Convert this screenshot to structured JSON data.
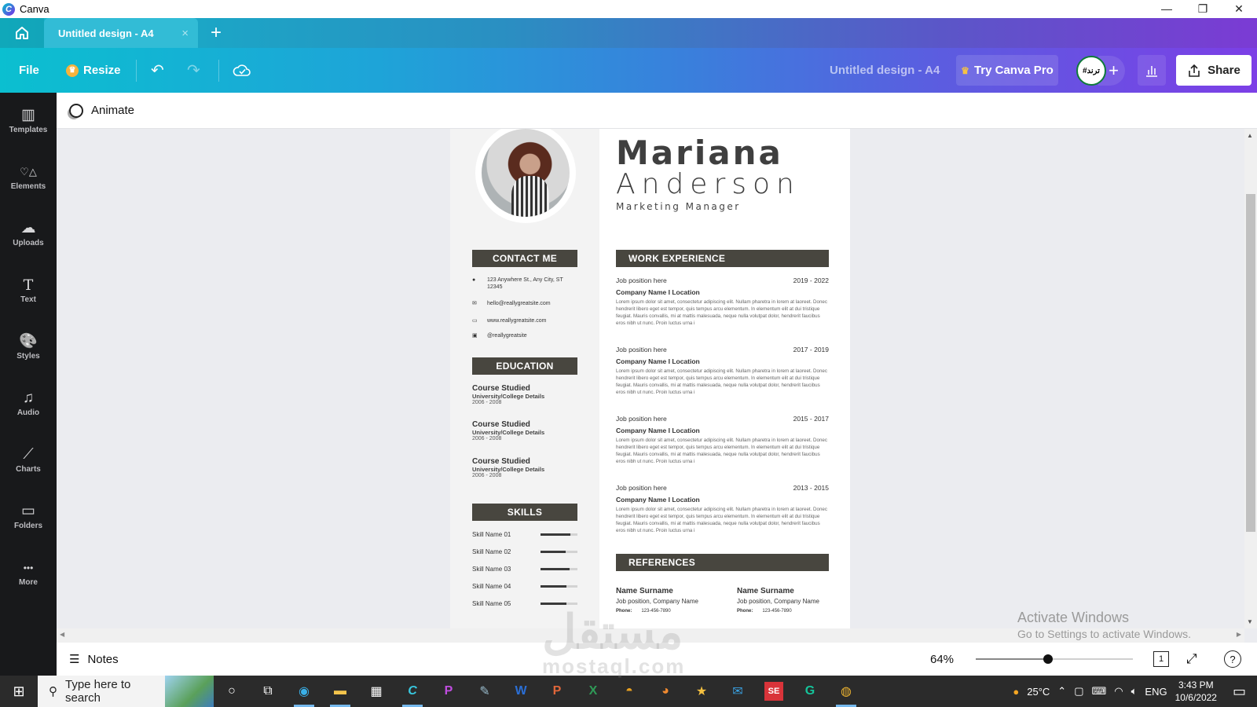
{
  "window": {
    "app_name": "Canva",
    "controls": {
      "minimize": "—",
      "restore": "❐",
      "close": "✕"
    }
  },
  "tabs": {
    "home_icon": "home-icon",
    "active_tab": "Untitled design - A4",
    "close": "×",
    "new_tab": "+"
  },
  "toolbar": {
    "file": "File",
    "resize": "Resize",
    "undo": "↶",
    "redo": "↷",
    "save_status_icon": "cloud-check-icon",
    "doc_title": "Untitled design - A4",
    "try_pro": "Try Canva Pro",
    "avatar_text": "#ترند",
    "add_people": "+",
    "insights_icon": "bar-chart-icon",
    "share": "Share"
  },
  "sidebar": {
    "items": [
      {
        "label": "Templates",
        "icon": "▥"
      },
      {
        "label": "Elements",
        "icon": "♡△"
      },
      {
        "label": "Uploads",
        "icon": "☁"
      },
      {
        "label": "Text",
        "icon": "T"
      },
      {
        "label": "Styles",
        "icon": "🎨"
      },
      {
        "label": "Audio",
        "icon": "♫"
      },
      {
        "label": "Charts",
        "icon": "⟋"
      },
      {
        "label": "Folders",
        "icon": "▭"
      },
      {
        "label": "More",
        "icon": "•••"
      }
    ]
  },
  "animate_bar": {
    "label": "Animate"
  },
  "resume": {
    "first_name": "Mariana",
    "last_name": "Anderson",
    "role": "Marketing Manager",
    "contact": {
      "heading": "CONTACT ME",
      "items": [
        {
          "icon": "●",
          "text": "123 Anywhere St., Any City, ST 12345"
        },
        {
          "icon": "✉",
          "text": "hello@reallygreatsite.com"
        },
        {
          "icon": "▭",
          "text": "www.reallygreatsite.com"
        },
        {
          "icon": "▣",
          "text": "@reallygreatsite"
        }
      ]
    },
    "education": {
      "heading": "EDUCATION",
      "items": [
        {
          "course": "Course Studied",
          "school": "University/College Details",
          "years": "2006 - 2008"
        },
        {
          "course": "Course Studied",
          "school": "University/College Details",
          "years": "2006 - 2008"
        },
        {
          "course": "Course Studied",
          "school": "University/College Details",
          "years": "2006 - 2008"
        }
      ]
    },
    "skills": {
      "heading": "SKILLS",
      "items": [
        {
          "name": "Skill Name 01",
          "level": 0.8
        },
        {
          "name": "Skill Name 02",
          "level": 0.68
        },
        {
          "name": "Skill Name 03",
          "level": 0.78
        },
        {
          "name": "Skill Name 04",
          "level": 0.7
        },
        {
          "name": "Skill Name 05",
          "level": 0.7
        }
      ]
    },
    "work": {
      "heading": "WORK EXPERIENCE",
      "items": [
        {
          "position": "Job position here",
          "years": "2019 - 2022",
          "company": "Company Name I Location",
          "desc": "Lorem ipsum dolor sit amet, consectetur adipiscing elit. Nullam pharetra in lorem at laoreet. Donec hendrerit libero eget est tempor, quis tempus arcu elementum. In elementum elit at dui tristique feugiat. Mauris convallis, mi at mattis malesuada, neque nulla volutpat dolor, hendrerit faucibus eros nibh ut nunc. Proin luctus urna i"
        },
        {
          "position": "Job position here",
          "years": "2017 - 2019",
          "company": "Company Name I Location",
          "desc": "Lorem ipsum dolor sit amet, consectetur adipiscing elit. Nullam pharetra in lorem at laoreet. Donec hendrerit libero eget est tempor, quis tempus arcu elementum. In elementum elit at dui tristique feugiat. Mauris convallis, mi at mattis malesuada, neque nulla volutpat dolor, hendrerit faucibus eros nibh ut nunc. Proin luctus urna i"
        },
        {
          "position": "Job position here",
          "years": "2015 - 2017",
          "company": "Company Name I Location",
          "desc": "Lorem ipsum dolor sit amet, consectetur adipiscing elit. Nullam pharetra in lorem at laoreet. Donec hendrerit libero eget est tempor, quis tempus arcu elementum. In elementum elit at dui tristique feugiat. Mauris convallis, mi at mattis malesuada, neque nulla volutpat dolor, hendrerit faucibus eros nibh ut nunc. Proin luctus urna i"
        },
        {
          "position": "Job position here",
          "years": "2013 - 2015",
          "company": "Company Name I Location",
          "desc": "Lorem ipsum dolor sit amet, consectetur adipiscing elit. Nullam pharetra in lorem at laoreet. Donec hendrerit libero eget est tempor, quis tempus arcu elementum. In elementum elit at dui tristique feugiat. Mauris convallis, mi at mattis malesuada, neque nulla volutpat dolor, hendrerit faucibus eros nibh ut nunc. Proin luctus urna i"
        }
      ]
    },
    "references": {
      "heading": "REFERENCES",
      "items": [
        {
          "name": "Name Surname",
          "position": "Job position, Company Name",
          "phone_label": "Phone:",
          "phone": "123-456-7890"
        },
        {
          "name": "Name Surname",
          "position": "Job position, Company Name",
          "phone_label": "Phone:",
          "phone": "123-456-7890"
        }
      ]
    }
  },
  "activate_windows": {
    "title": "Activate Windows",
    "subtitle": "Go to Settings to activate Windows."
  },
  "bottom_bar": {
    "notes": "Notes",
    "zoom": "64%",
    "zoom_level": 0.64,
    "page_count": "1"
  },
  "taskbar": {
    "search_placeholder": "Type here to search",
    "apps": [
      "cortana",
      "task-view",
      "edge",
      "file-explorer",
      "store",
      "canva",
      "picsart",
      "paint",
      "word",
      "powerpoint",
      "excel",
      "audio",
      "blender",
      "movie-maker",
      "mail",
      "se-app",
      "grammarly",
      "chrome"
    ],
    "weather": "25°C",
    "language": "ENG",
    "time": "3:43 PM",
    "date": "10/6/2022"
  },
  "watermark": {
    "arabic": "مستقل",
    "latin": "mostaql.com"
  }
}
